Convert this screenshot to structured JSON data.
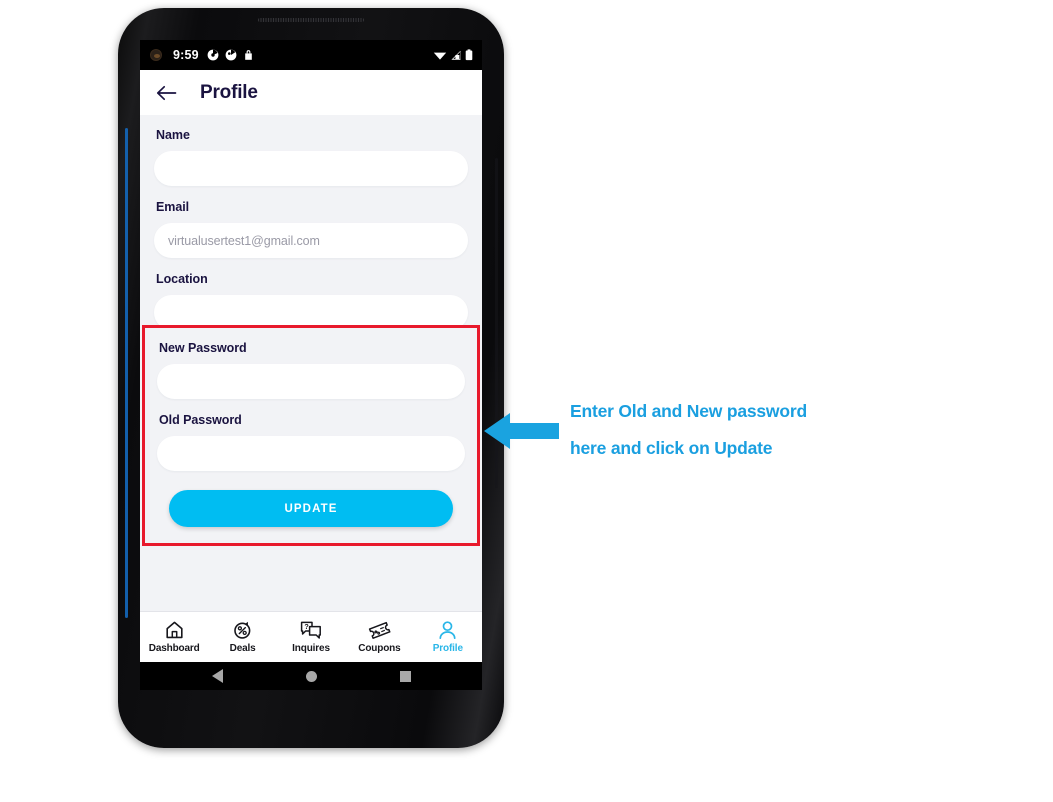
{
  "device": {
    "status_bar": {
      "time": "9:59",
      "left_icons": [
        "account-avatar-icon",
        "partial-circle-icon",
        "partial-circle-icon",
        "lock-icon"
      ],
      "right_icons": [
        "wifi-icon",
        "cellular-signal-icon",
        "battery-icon"
      ]
    },
    "android_nav": {
      "back_label": "back-button",
      "home_label": "home-button",
      "recents_label": "recents-button"
    }
  },
  "app_bar": {
    "back_icon": "arrow-left-icon",
    "title": "Profile"
  },
  "form": {
    "fields": [
      {
        "label": "Name",
        "value": "",
        "placeholder": ""
      },
      {
        "label": "Email",
        "value": "virtualusertest1@gmail.com",
        "placeholder": ""
      },
      {
        "label": "Location",
        "value": "",
        "placeholder": ""
      }
    ],
    "password_section": {
      "fields": [
        {
          "label": "New Password",
          "value": "",
          "placeholder": ""
        },
        {
          "label": "Old Password",
          "value": "",
          "placeholder": ""
        }
      ],
      "submit_label": "UPDATE"
    }
  },
  "bottom_nav": {
    "items": [
      {
        "label": "Dashboard",
        "icon": "home-icon",
        "active": false
      },
      {
        "label": "Deals",
        "icon": "discount-tag-icon",
        "active": false
      },
      {
        "label": "Inquires",
        "icon": "chat-question-icon",
        "active": false
      },
      {
        "label": "Coupons",
        "icon": "coupon-ticket-icon",
        "active": false
      },
      {
        "label": "Profile",
        "icon": "person-icon",
        "active": true
      }
    ]
  },
  "annotation": {
    "line1": "Enter Old and New password",
    "line2": "here and click on Update",
    "arrow_direction": "left",
    "highlight_color": "#e8192c",
    "accent_color": "#1a9fe0"
  }
}
